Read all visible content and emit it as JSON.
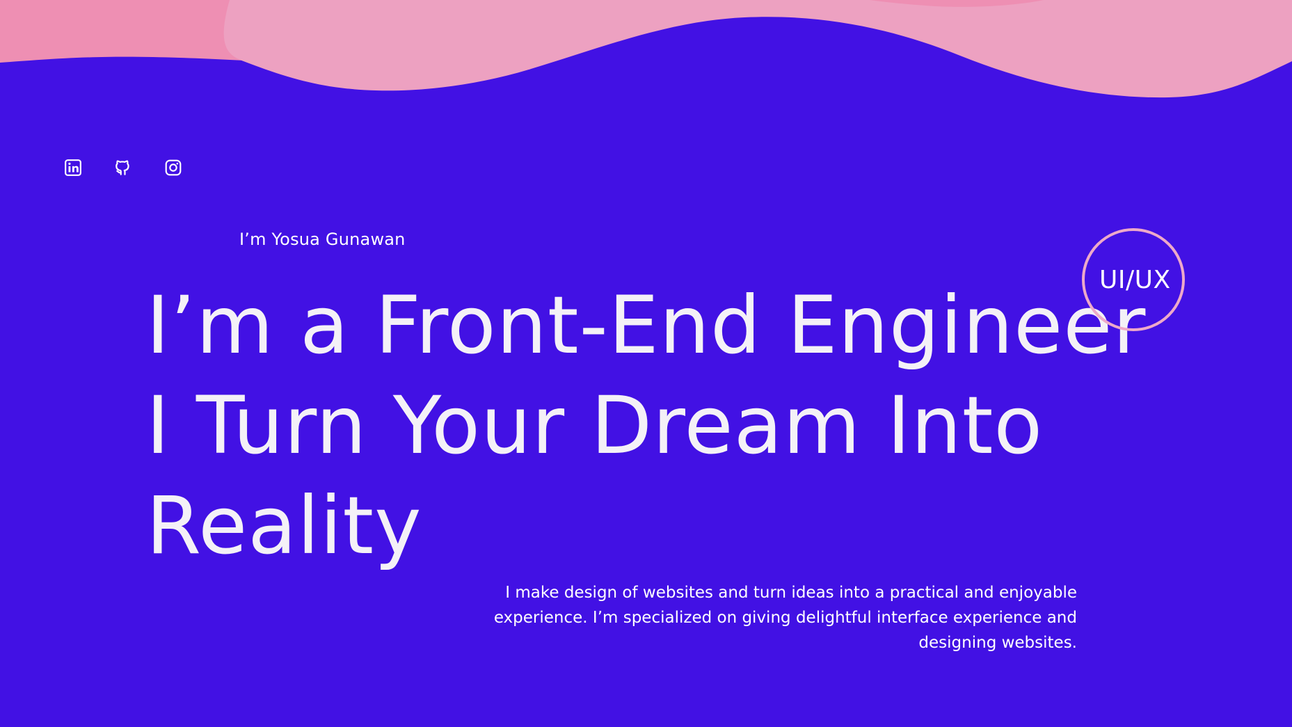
{
  "colors": {
    "background": "#4211e4",
    "wave_dark": "#ee8fb3",
    "wave_light": "#eda1c1",
    "badge_ring": "#eea9c9",
    "text": "#f4f1f7"
  },
  "social": {
    "items": [
      {
        "label": "LinkedIn",
        "icon": "linkedin-icon"
      },
      {
        "label": "GitHub",
        "icon": "github-icon"
      },
      {
        "label": "Instagram",
        "icon": "instagram-icon"
      }
    ]
  },
  "hero": {
    "intro": "I’m Yosua Gunawan",
    "headline_lines": [
      "I’m a Front-End Engineer",
      "I Turn Your Dream Into",
      "Reality"
    ],
    "badge": "UI/UX",
    "description": "I make design of websites and turn ideas into a practical and enjoyable experience. I’m specialized on giving delightful interface experience and designing websites."
  }
}
